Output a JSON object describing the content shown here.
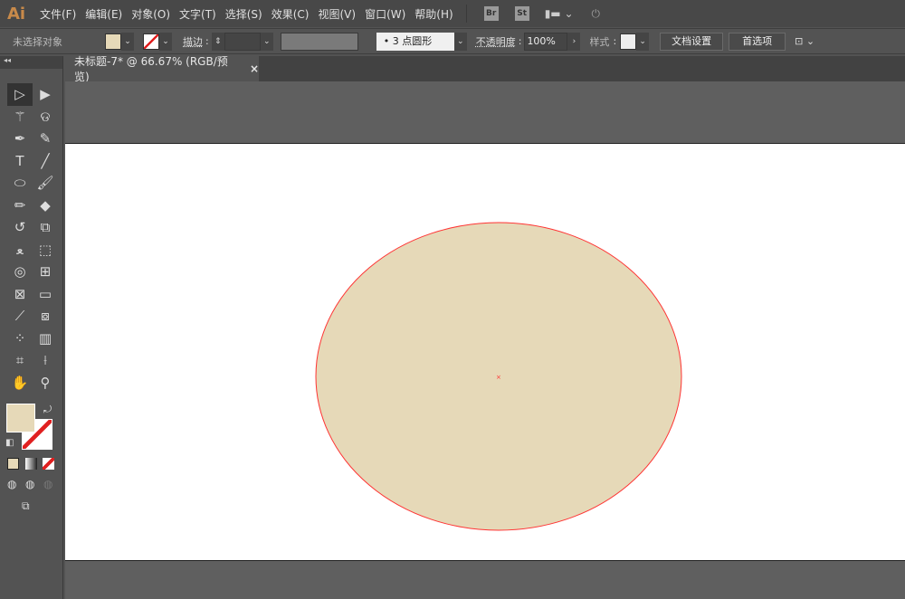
{
  "app": {
    "logo": "Ai"
  },
  "menu": [
    "文件(F)",
    "编辑(E)",
    "对象(O)",
    "文字(T)",
    "选择(S)",
    "效果(C)",
    "视图(V)",
    "窗口(W)",
    "帮助(H)"
  ],
  "app_buttons": {
    "bridge": "Br",
    "stock": "St"
  },
  "control": {
    "selection_status": "未选择对象",
    "stroke_label": "描边",
    "brush_profile": "3 点圆形",
    "opacity_label": "不透明度",
    "opacity_value": "100%",
    "style_label": "样式",
    "doc_setup": "文档设置",
    "preferences": "首选项"
  },
  "colors": {
    "fill": "#e6d9b8",
    "stroke": "#ff3333",
    "accent": "#c88a4a"
  },
  "document": {
    "tab_title": "未标题-7* @ 66.67% (RGB/预览)",
    "close": "×"
  },
  "tools": [
    "selection-icon",
    "direct-selection-icon",
    "magic-wand-icon",
    "lasso-icon",
    "pen-icon",
    "curvature-icon",
    "type-icon",
    "line-icon",
    "ellipse-icon",
    "paintbrush-icon",
    "pencil-icon",
    "eraser-icon",
    "rotate-icon",
    "scale-icon",
    "warp-icon",
    "free-transform-icon",
    "shape-builder-icon",
    "perspective-grid-icon",
    "mesh-icon",
    "gradient-icon",
    "eyedropper-icon",
    "blend-icon",
    "symbol-sprayer-icon",
    "column-graph-icon",
    "artboard-icon",
    "slice-icon",
    "hand-icon",
    "zoom-icon"
  ]
}
